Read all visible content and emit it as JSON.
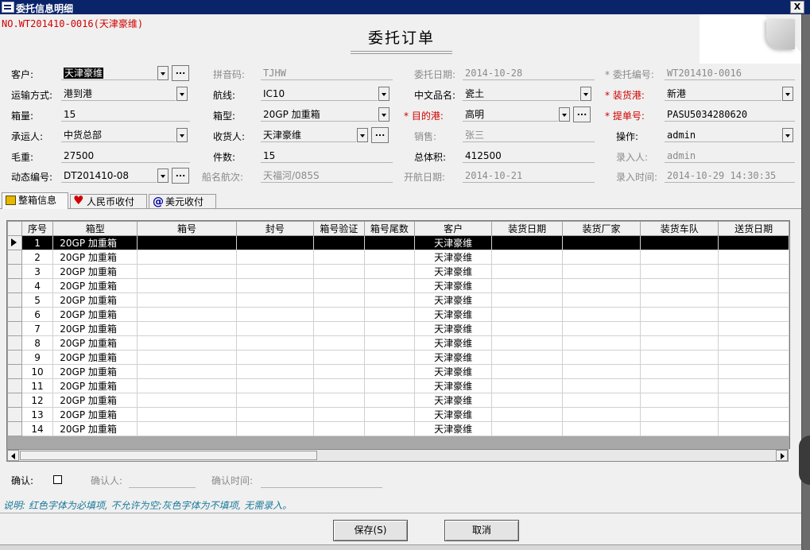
{
  "window": {
    "title": "委托信息明细"
  },
  "order_no": "NO.WT201410-0016(天津豪维)",
  "page_title": "委托订单",
  "form": {
    "customer": {
      "label": "客户:",
      "value": "天津豪维"
    },
    "pinyin": {
      "label": "拼音码:",
      "value": "TJHW"
    },
    "order_date": {
      "label": "委托日期:",
      "value": "2014-10-28"
    },
    "order_id": {
      "label": "* 委托编号:",
      "value": "WT201410-0016"
    },
    "transport": {
      "label": "运输方式:",
      "value": "港到港"
    },
    "route": {
      "label": "航线:",
      "value": "IC10"
    },
    "goods_name": {
      "label": "中文品名:",
      "value": "瓷土"
    },
    "load_port": {
      "label": "* 装货港:",
      "value": "新港"
    },
    "box_count": {
      "label": "箱量:",
      "value": "15"
    },
    "box_type": {
      "label": "箱型:",
      "value": "20GP 加重箱"
    },
    "dest_port": {
      "label": "* 目的港:",
      "value": "高明"
    },
    "bl_no": {
      "label": "* 提单号:",
      "value": "PASU5034280620"
    },
    "carrier": {
      "label": "承运人:",
      "value": "中货总部"
    },
    "consignee": {
      "label": "收货人:",
      "value": "天津豪维"
    },
    "sales": {
      "label": "销售:",
      "value": "张三"
    },
    "operator": {
      "label": "操作:",
      "value": "admin"
    },
    "gross_weight": {
      "label": "毛重:",
      "value": "27500"
    },
    "pieces": {
      "label": "件数:",
      "value": "15"
    },
    "volume": {
      "label": "总体积:",
      "value": "412500"
    },
    "entered_by": {
      "label": "录入人:",
      "value": "admin"
    },
    "dyn_no": {
      "label": "动态编号:",
      "value": "DT201410-08"
    },
    "vessel": {
      "label": "船名航次:",
      "value": "天福河/085S"
    },
    "sail_date": {
      "label": "开航日期:",
      "value": "2014-10-21"
    },
    "entry_time": {
      "label": "录入时间:",
      "value": "2014-10-29 14:30:35"
    }
  },
  "ellipsis": "...",
  "tabs": [
    {
      "label": "整箱信息",
      "icon": "box-icon"
    },
    {
      "label": "人民币收付",
      "icon": "heart-icon"
    },
    {
      "label": "美元收付",
      "icon": "at-icon"
    }
  ],
  "grid": {
    "columns": [
      "序号",
      "箱型",
      "箱号",
      "封号",
      "箱号验证",
      "箱号尾数",
      "客户",
      "装货日期",
      "装货厂家",
      "装货车队",
      "送货日期"
    ],
    "rows": [
      [
        "1",
        "20GP 加重箱",
        "天津豪维"
      ],
      [
        "2",
        "20GP 加重箱",
        "天津豪维"
      ],
      [
        "3",
        "20GP 加重箱",
        "天津豪维"
      ],
      [
        "4",
        "20GP 加重箱",
        "天津豪维"
      ],
      [
        "5",
        "20GP 加重箱",
        "天津豪维"
      ],
      [
        "6",
        "20GP 加重箱",
        "天津豪维"
      ],
      [
        "7",
        "20GP 加重箱",
        "天津豪维"
      ],
      [
        "8",
        "20GP 加重箱",
        "天津豪维"
      ],
      [
        "9",
        "20GP 加重箱",
        "天津豪维"
      ],
      [
        "10",
        "20GP 加重箱",
        "天津豪维"
      ],
      [
        "11",
        "20GP 加重箱",
        "天津豪维"
      ],
      [
        "12",
        "20GP 加重箱",
        "天津豪维"
      ],
      [
        "13",
        "20GP 加重箱",
        "天津豪维"
      ],
      [
        "14",
        "20GP 加重箱",
        "天津豪维"
      ],
      [
        "15",
        "20GP 加重箱",
        "天津豪维"
      ]
    ]
  },
  "confirm": {
    "label": "确认:",
    "confirmer_label": "确认人:",
    "time_label": "确认时间:"
  },
  "note": "说明: 红色字体为必填项, 不允许为空;灰色字体为不填项, 无需录入。",
  "buttons": {
    "save": "保存(S)",
    "cancel": "取消"
  },
  "close_glyph": "X"
}
